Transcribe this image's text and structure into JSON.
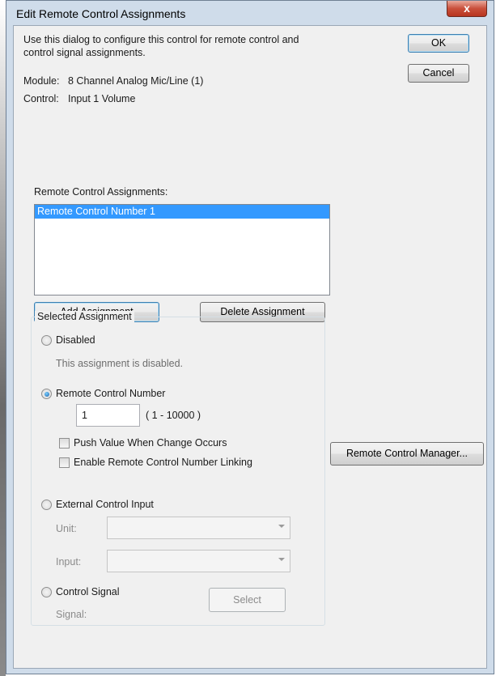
{
  "window": {
    "title": "Edit Remote Control Assignments",
    "close_glyph": "x"
  },
  "intro": {
    "line1": "Use this dialog to configure this control for remote control and",
    "line2": "control signal assignments."
  },
  "info": {
    "module_label": "Module:",
    "module_value": "8 Channel Analog Mic/Line (1)",
    "control_label": "Control:",
    "control_value": "Input 1 Volume"
  },
  "buttons": {
    "ok": "OK",
    "cancel": "Cancel",
    "add": "Add Assignment",
    "delete": "Delete Assignment",
    "manager": "Remote Control Manager...",
    "select": "Select"
  },
  "assignments": {
    "label": "Remote Control Assignments:",
    "items": [
      "Remote Control Number 1"
    ]
  },
  "selected": {
    "group_label": "Selected Assignment",
    "disabled_label": "Disabled",
    "disabled_desc": "This assignment is disabled.",
    "rcn_label": "Remote Control Number",
    "rcn_value": "1",
    "rcn_range": "( 1 - 10000 )",
    "push_label": "Push Value When Change Occurs",
    "link_label": "Enable Remote Control Number Linking",
    "eci_label": "External Control Input",
    "unit_label": "Unit:",
    "input_label": "Input:",
    "unit_value": "",
    "input_value": "",
    "signal_option_label": "Control Signal",
    "signal_label": "Signal:"
  }
}
